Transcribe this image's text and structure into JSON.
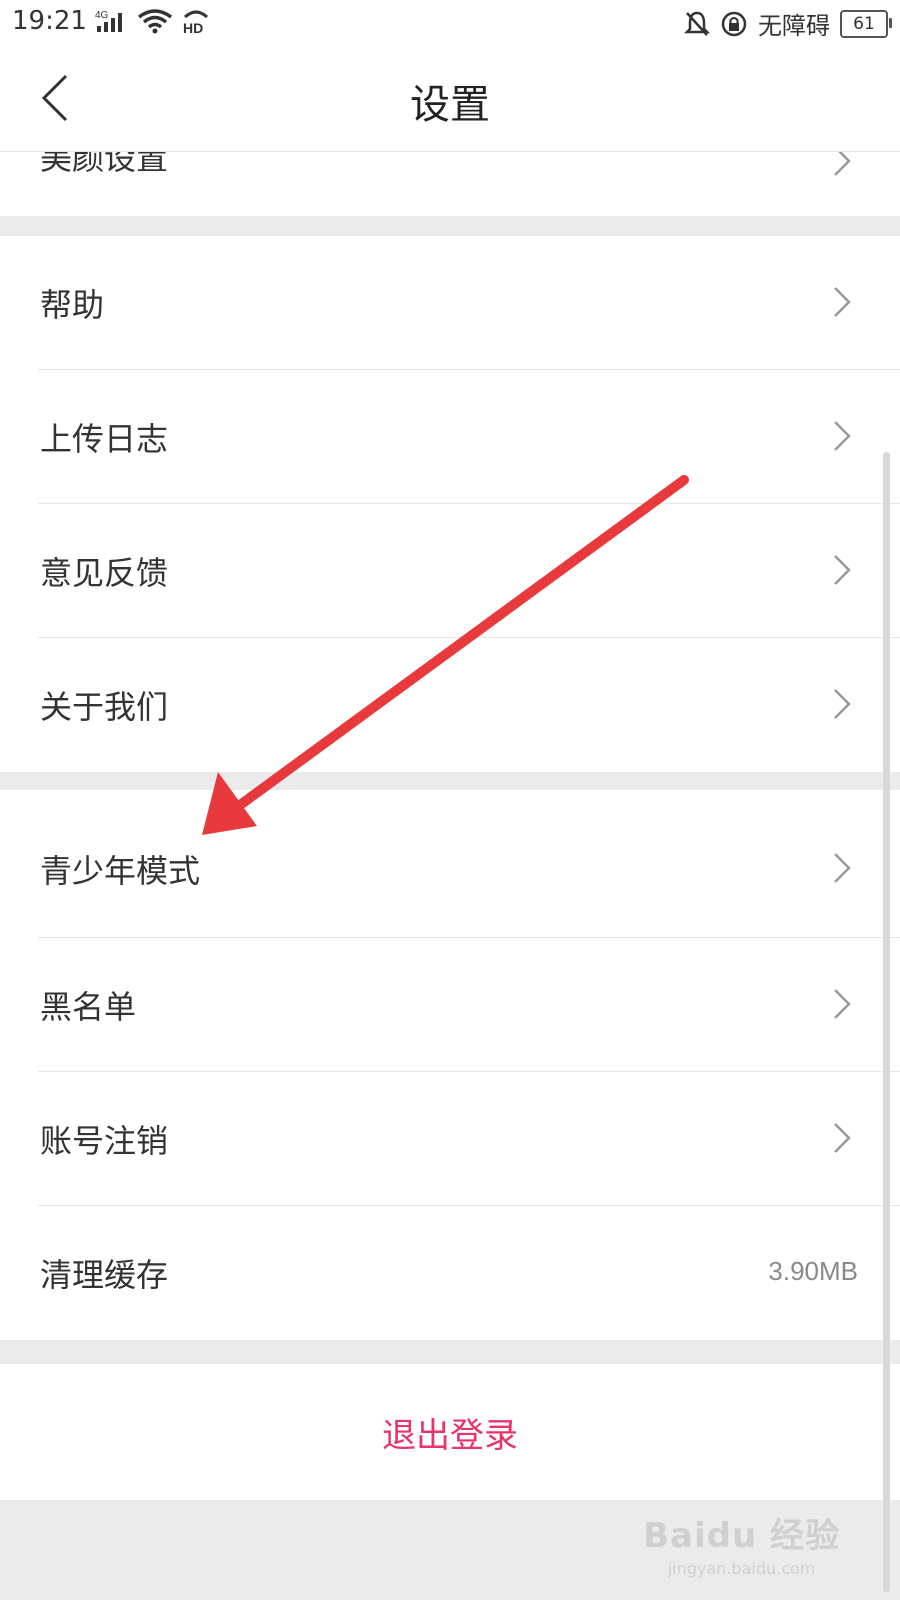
{
  "status_bar": {
    "time": "19:21",
    "network": "4G",
    "hd": "HD",
    "accessibility": "无障碍",
    "battery": "61"
  },
  "header": {
    "title": "设置"
  },
  "partial_row": {
    "label": "美颜设置"
  },
  "section_support": {
    "items": [
      {
        "label": "帮助"
      },
      {
        "label": "上传日志"
      },
      {
        "label": "意见反馈"
      },
      {
        "label": "关于我们"
      }
    ]
  },
  "section_account": {
    "items": [
      {
        "label": "青少年模式"
      },
      {
        "label": "黑名单"
      },
      {
        "label": "账号注销"
      },
      {
        "label": "清理缓存",
        "value": "3.90MB"
      }
    ]
  },
  "logout": {
    "label": "退出登录"
  },
  "watermark": {
    "main": "Baidu 经验",
    "sub": "jingyan.baidu.com"
  },
  "colors": {
    "accent": "#e8336b",
    "annotation_arrow": "#e8393c"
  }
}
